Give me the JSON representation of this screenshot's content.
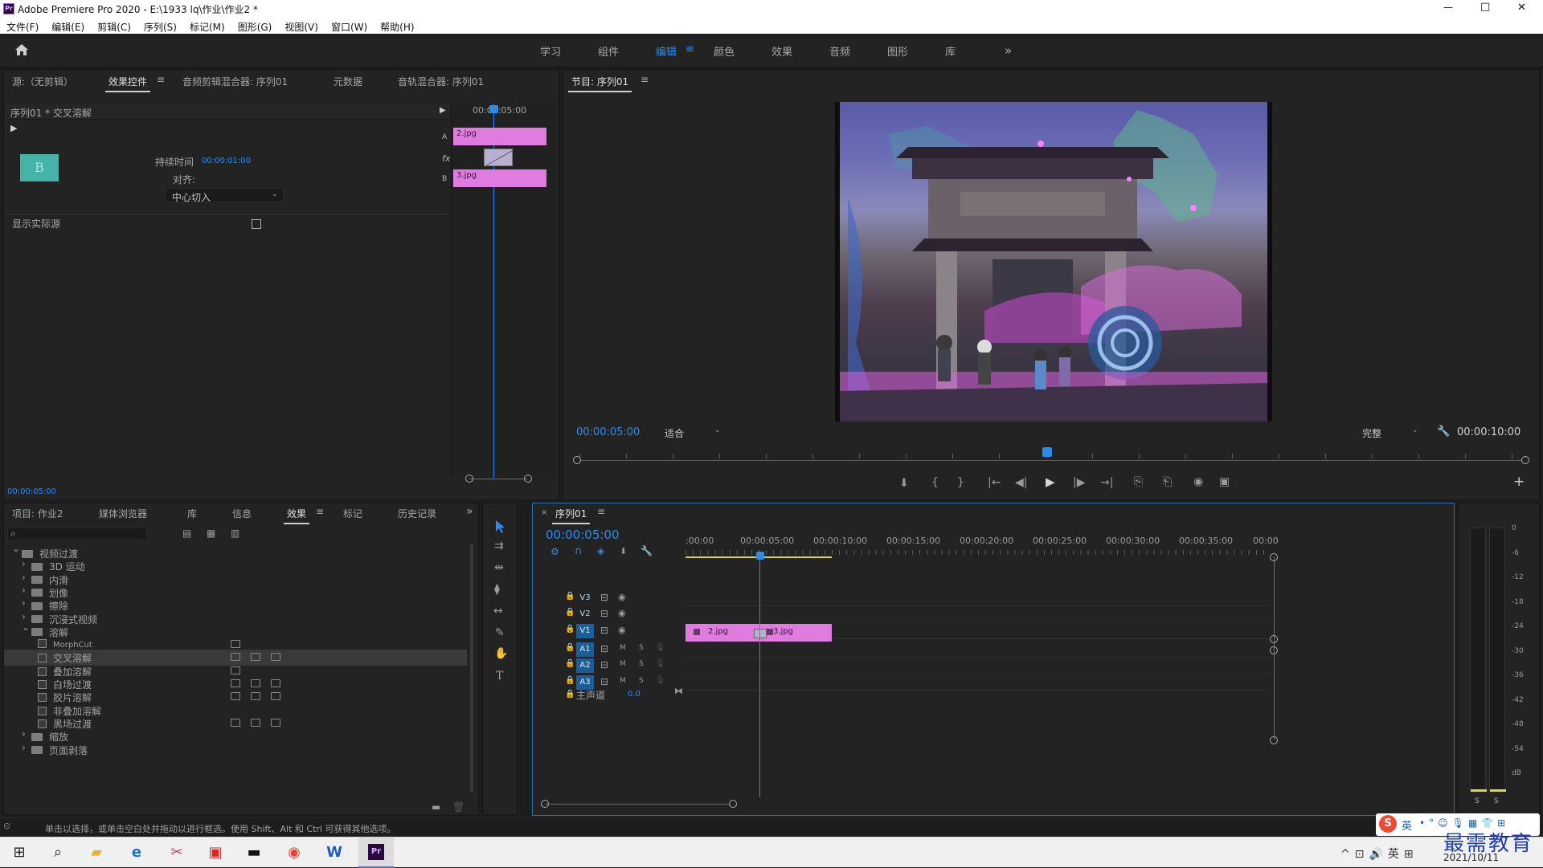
{
  "window": {
    "title": "Adobe Premiere Pro 2020 - E:\\1933 lq\\作业\\作业2 *",
    "controls": [
      "—",
      "□",
      "✕"
    ]
  },
  "menu": [
    "文件(F)",
    "编辑(E)",
    "剪辑(C)",
    "序列(S)",
    "标记(M)",
    "图形(G)",
    "视图(V)",
    "窗口(W)",
    "帮助(H)"
  ],
  "workspaces": {
    "items": [
      "学习",
      "组件",
      "编辑",
      "颜色",
      "效果",
      "音频",
      "图形",
      "库"
    ],
    "active": "编辑",
    "more": "»"
  },
  "source_panel": {
    "tabs": [
      "源:（无剪辑）",
      "效果控件",
      "音频剪辑混合器: 序列01",
      "元数据",
      "音轨混合器: 序列01"
    ],
    "active_tab": "效果控件",
    "header": "序列01 * 交叉溶解",
    "duration_label": "持续时间",
    "duration_value": "00:00:01:00",
    "align_label": "对齐:",
    "align_value": "中心切入",
    "show_actual_sources": "显示实际源",
    "thumb_letter": "B",
    "mini_timecode": "00:00:05:00",
    "clip_a": "2.jpg",
    "clip_b": "3.jpg",
    "track_a": "A",
    "track_b": "B",
    "fx_label": "fx",
    "bottom_timecode": "00:00:05:00"
  },
  "program_monitor": {
    "title": "节目: 序列01",
    "timecode_current": "00:00:05:00",
    "fit": "适合",
    "quality": "完整",
    "timecode_total": "00:00:10:00",
    "controls": [
      "⬇",
      "{",
      "}",
      "|←",
      "◀|",
      "▶",
      "|▶",
      "→|",
      "⎘",
      "⎗",
      "◉",
      "▣"
    ],
    "add_button": "+"
  },
  "project_panel": {
    "tabs": [
      "项目: 作业2",
      "媒体浏览器",
      "库",
      "信息",
      "效果",
      "标记",
      "历史记录"
    ],
    "active_tab": "效果",
    "more": "»",
    "tree": [
      {
        "label": "视频过渡",
        "level": 0,
        "type": "folder",
        "open": true
      },
      {
        "label": "3D 运动",
        "level": 1,
        "type": "folder"
      },
      {
        "label": "内滑",
        "level": 1,
        "type": "folder"
      },
      {
        "label": "划像",
        "level": 1,
        "type": "folder"
      },
      {
        "label": "擦除",
        "level": 1,
        "type": "folder"
      },
      {
        "label": "沉浸式视频",
        "level": 1,
        "type": "folder"
      },
      {
        "label": "溶解",
        "level": 1,
        "type": "folder",
        "open": true
      },
      {
        "label": "MorphCut",
        "level": 2,
        "type": "effect",
        "badges": 1
      },
      {
        "label": "交叉溶解",
        "level": 2,
        "type": "effect",
        "badges": 3,
        "selected": true
      },
      {
        "label": "叠加溶解",
        "level": 2,
        "type": "effect",
        "badges": 1
      },
      {
        "label": "白场过渡",
        "level": 2,
        "type": "effect",
        "badges": 3
      },
      {
        "label": "胶片溶解",
        "level": 2,
        "type": "effect",
        "badges": 3
      },
      {
        "label": "非叠加溶解",
        "level": 2,
        "type": "effect",
        "badges": 0
      },
      {
        "label": "黑场过渡",
        "level": 2,
        "type": "effect",
        "badges": 3
      },
      {
        "label": "缩放",
        "level": 1,
        "type": "folder"
      },
      {
        "label": "页面剥落",
        "level": 1,
        "type": "folder"
      }
    ]
  },
  "timeline": {
    "close": "×",
    "title": "序列01",
    "timecode": "00:00:05:00",
    "ruler": [
      ":00:00",
      "00:00:05:00",
      "00:00:10:00",
      "00:00:15:00",
      "00:00:20:00",
      "00:00:25:00",
      "00:00:30:00",
      "00:00:35:00",
      "00:00"
    ],
    "tracks": [
      {
        "id": "V3",
        "kind": "video"
      },
      {
        "id": "V2",
        "kind": "video"
      },
      {
        "id": "V1",
        "kind": "video",
        "active": true
      },
      {
        "id": "A1",
        "kind": "audio",
        "active": true
      },
      {
        "id": "A2",
        "kind": "audio",
        "active": true
      },
      {
        "id": "A3",
        "kind": "audio",
        "active": true
      }
    ],
    "mute": "M",
    "solo": "S",
    "master_label": "主声道",
    "master_value": "0.0",
    "clips": [
      {
        "name": "2.jpg",
        "start": 0,
        "end": 5
      },
      {
        "name": "3.jpg",
        "start": 5,
        "end": 10
      }
    ],
    "playhead_seconds": 5
  },
  "audio_meter": {
    "scale": [
      "0",
      "-6",
      "-12",
      "-18",
      "-24",
      "-30",
      "-36",
      "-42",
      "-48",
      "-54",
      "dB"
    ],
    "solo_buttons": [
      "S",
      "S"
    ]
  },
  "status_bar": "单击以选择，或单击空白处并拖动以进行框选。使用 Shift、Alt 和 Ctrl 可获得其他选项。",
  "ime": {
    "label": "英"
  },
  "watermark": "最需教育",
  "taskbar": {
    "date": "2021/10/11"
  }
}
